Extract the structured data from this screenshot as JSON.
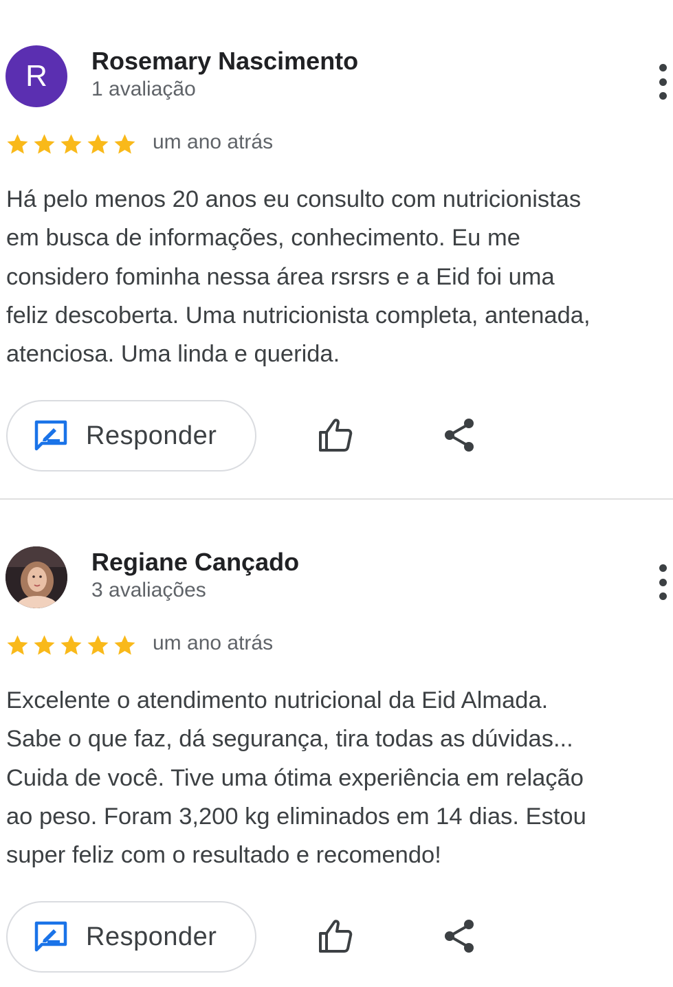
{
  "colors": {
    "star": "#f9b91a",
    "avatar_letter_bg": "#5b2fb1",
    "reply_icon": "#1a73e8",
    "icon_gray": "#3c4043",
    "divider": "#e0e0e0"
  },
  "reviews": [
    {
      "author": {
        "name": "Rosemary Nascimento",
        "review_count": "1 avaliação",
        "avatar_letter": "R"
      },
      "rating": 5,
      "date": "um ano atrás",
      "text_lines": [
        "Há pelo menos 20 anos eu consulto com nutricionistas",
        "em busca de informações, conhecimento. Eu me",
        "considero fominha nessa área rsrsrs e a Eid foi uma",
        "feliz descoberta. Uma nutricionista completa, antenada,",
        "atenciosa. Uma linda e querida."
      ],
      "actions": {
        "reply_label": "Responder",
        "reply_icon": "reply-icon",
        "like_icon": "thumbs-up-icon",
        "share_icon": "share-icon"
      }
    },
    {
      "author": {
        "name": "Regiane Cançado",
        "review_count": "3 avaliações",
        "avatar_image": "profile-photo"
      },
      "rating": 5,
      "date": "um ano atrás",
      "text_lines": [
        "Excelente o atendimento nutricional da Eid Almada.",
        "Sabe o que faz, dá segurança, tira todas as dúvidas...",
        "Cuida de você. Tive uma ótima experiência em relação",
        "ao peso. Foram 3,200 kg eliminados em 14 dias. Estou",
        "super feliz com o resultado e recomendo!"
      ],
      "actions": {
        "reply_label": "Responder",
        "reply_icon": "reply-icon",
        "like_icon": "thumbs-up-icon",
        "share_icon": "share-icon"
      }
    }
  ]
}
